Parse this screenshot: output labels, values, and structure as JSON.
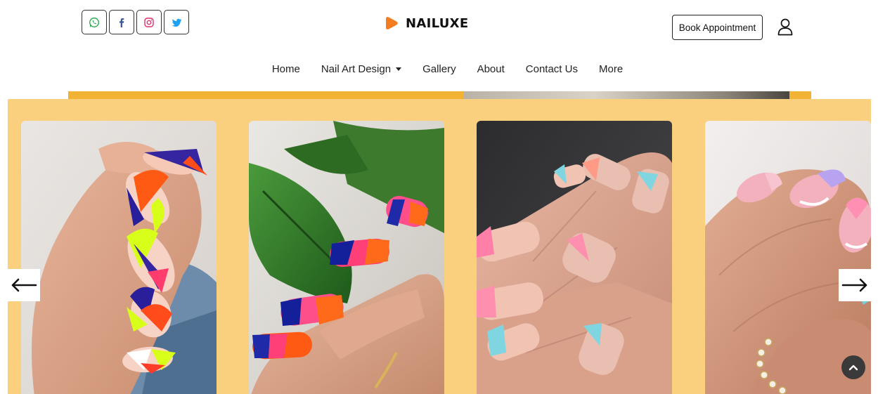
{
  "header": {
    "social": [
      {
        "name": "whatsapp-icon",
        "color": "#25a244"
      },
      {
        "name": "facebook-icon",
        "color": "#3b5998"
      },
      {
        "name": "instagram-icon",
        "color": "#e1306c"
      },
      {
        "name": "twitter-icon",
        "color": "#1da1f2"
      }
    ],
    "brand": {
      "name": "NAILUXE",
      "mark_color": "#f57c1f"
    },
    "book_label": "Book Appointment",
    "user_icon": "user-icon"
  },
  "nav": {
    "items": [
      {
        "label": "Home"
      },
      {
        "label": "Nail Art Design",
        "dropdown": true
      },
      {
        "label": "Gallery"
      },
      {
        "label": "About"
      },
      {
        "label": "Contact Us"
      },
      {
        "label": "More"
      }
    ]
  },
  "carousel": {
    "background": "#fad07f",
    "images": [
      {
        "name": "nail-image-neon-geometric"
      },
      {
        "name": "nail-image-neon-stripes-leaf"
      },
      {
        "name": "nail-image-pastel-french-tips"
      },
      {
        "name": "nail-image-pink-lavender-tips"
      }
    ],
    "prev_icon": "arrow-left-icon",
    "next_icon": "arrow-right-icon",
    "scroll_top_icon": "chevron-up-icon"
  }
}
